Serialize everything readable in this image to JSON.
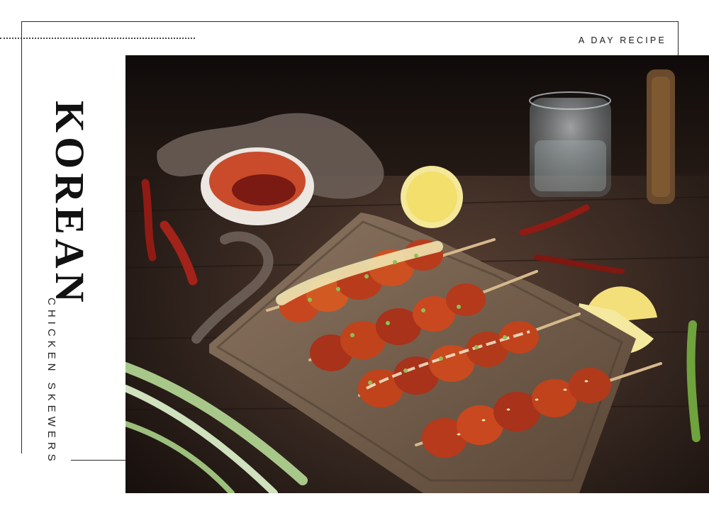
{
  "header": {
    "kicker": "A DAY RECIPE"
  },
  "title": {
    "main": "KOREAN",
    "sub": "CHICKEN SKEWERS"
  },
  "photo": {
    "subject": "korean-chicken-skewers-photo",
    "colors": {
      "table": "#3b2a22",
      "board": "#7a6552",
      "sauce": "#b2341c",
      "lemon": "#f2e08a",
      "scallion": "#7fb04a"
    }
  }
}
